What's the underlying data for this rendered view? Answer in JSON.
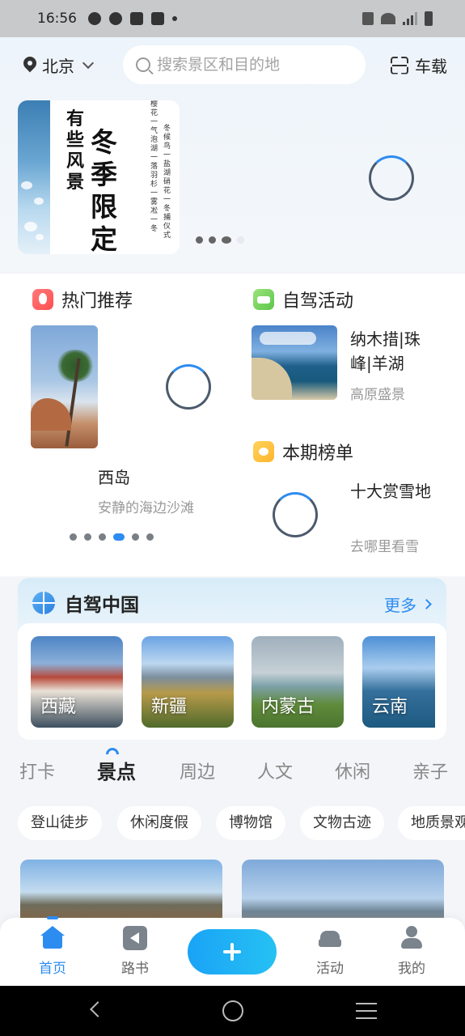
{
  "status_bar": {
    "time": "16:56"
  },
  "header": {
    "city": "北京",
    "search_placeholder": "搜索景区和目的地",
    "car_mode_label": "车载"
  },
  "banner": {
    "headline_small": "有些风景",
    "headline_big": "冬季限定",
    "poem_lines": [
      "冬候鸟一盐湖硝花一冬捕仪式",
      "樱花一气泡湖一落羽杉一雾凇一冬"
    ],
    "page_count": 4,
    "active_page": 3
  },
  "hot": {
    "title": "热门推荐",
    "item_title": "西岛",
    "item_subtitle": "安静的海边沙滩",
    "page_count": 6,
    "active_page": 4
  },
  "drive_event": {
    "title": "自驾活动",
    "item_title": "纳木措|珠峰|羊湖",
    "item_subtitle": "高原盛景"
  },
  "ranking": {
    "title": "本期榜单",
    "item_title": "十大赏雪地",
    "item_subtitle": "去哪里看雪"
  },
  "china_drive": {
    "title": "自驾中国",
    "more_label": "更多",
    "regions": [
      "西藏",
      "新疆",
      "内蒙古",
      "云南"
    ]
  },
  "category_tabs": [
    "打卡",
    "景点",
    "周边",
    "人文",
    "休闲",
    "亲子"
  ],
  "active_tab": "景点",
  "chips": [
    "登山徒步",
    "休闲度假",
    "博物馆",
    "文物古迹",
    "地质景观"
  ],
  "bottom_nav": [
    {
      "label": "首页",
      "icon": "home-icon",
      "active": true
    },
    {
      "label": "路书",
      "icon": "roadbook-icon",
      "active": false
    },
    {
      "label": "",
      "icon": "plus-icon",
      "active": false
    },
    {
      "label": "活动",
      "icon": "car-icon",
      "active": false
    },
    {
      "label": "我的",
      "icon": "profile-icon",
      "active": false
    }
  ],
  "colors": {
    "accent": "#2d8cf0",
    "plus_gradient_start": "#1aa3f6",
    "plus_gradient_end": "#26c1f3"
  }
}
